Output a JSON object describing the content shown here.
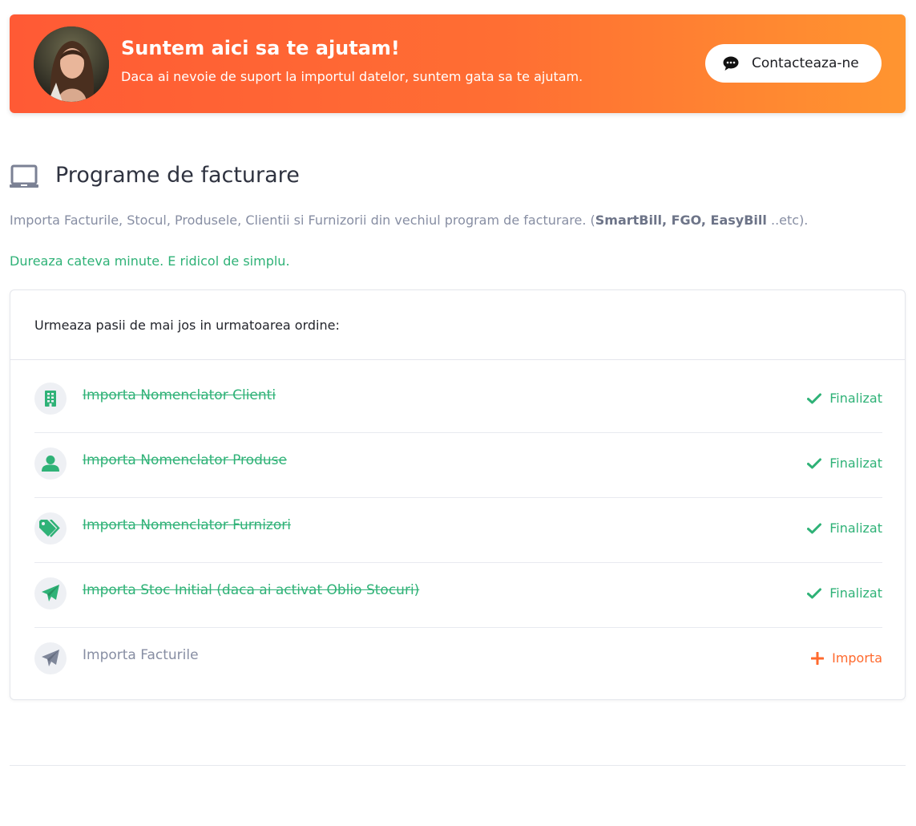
{
  "banner": {
    "title": "Suntem aici sa te ajutam!",
    "subtitle": "Daca ai nevoie de suport la importul datelor, suntem gata sa te ajutam.",
    "contact_label": "Contacteaza-ne",
    "gradient": [
      "#ff5a35",
      "#ff9530"
    ]
  },
  "section": {
    "icon": "laptop-icon",
    "title": "Programe de facturare",
    "desc_prefix": "Importa Facturile, Stocul, Produsele, Clientii si Furnizorii din vechiul program de facturare. (",
    "desc_bold": "SmartBill, FGO, EasyBill",
    "desc_suffix": " ..etc).",
    "note": "Dureaza cateva minute. E ridicol de simplu."
  },
  "card": {
    "header": "Urmeaza pasii de mai jos in urmatoarea ordine:",
    "steps": [
      {
        "icon": "building-icon",
        "label": "Importa Nomenclator Clienti",
        "status": "Finalizat",
        "done": true
      },
      {
        "icon": "user-icon",
        "label": "Importa Nomenclator Produse",
        "status": "Finalizat",
        "done": true
      },
      {
        "icon": "tags-icon",
        "label": "Importa Nomenclator Furnizori",
        "status": "Finalizat",
        "done": true
      },
      {
        "icon": "paper-plane-icon",
        "label": "Importa Stoc Initial (daca ai activat Oblio Stocuri)",
        "status": "Finalizat",
        "done": true
      },
      {
        "icon": "paper-plane-icon",
        "label": "Importa Facturile",
        "status": "Importa",
        "done": false
      }
    ]
  },
  "colors": {
    "accent_green": "#2fb277",
    "accent_orange": "#ff6a2e",
    "muted": "#878ea3"
  }
}
